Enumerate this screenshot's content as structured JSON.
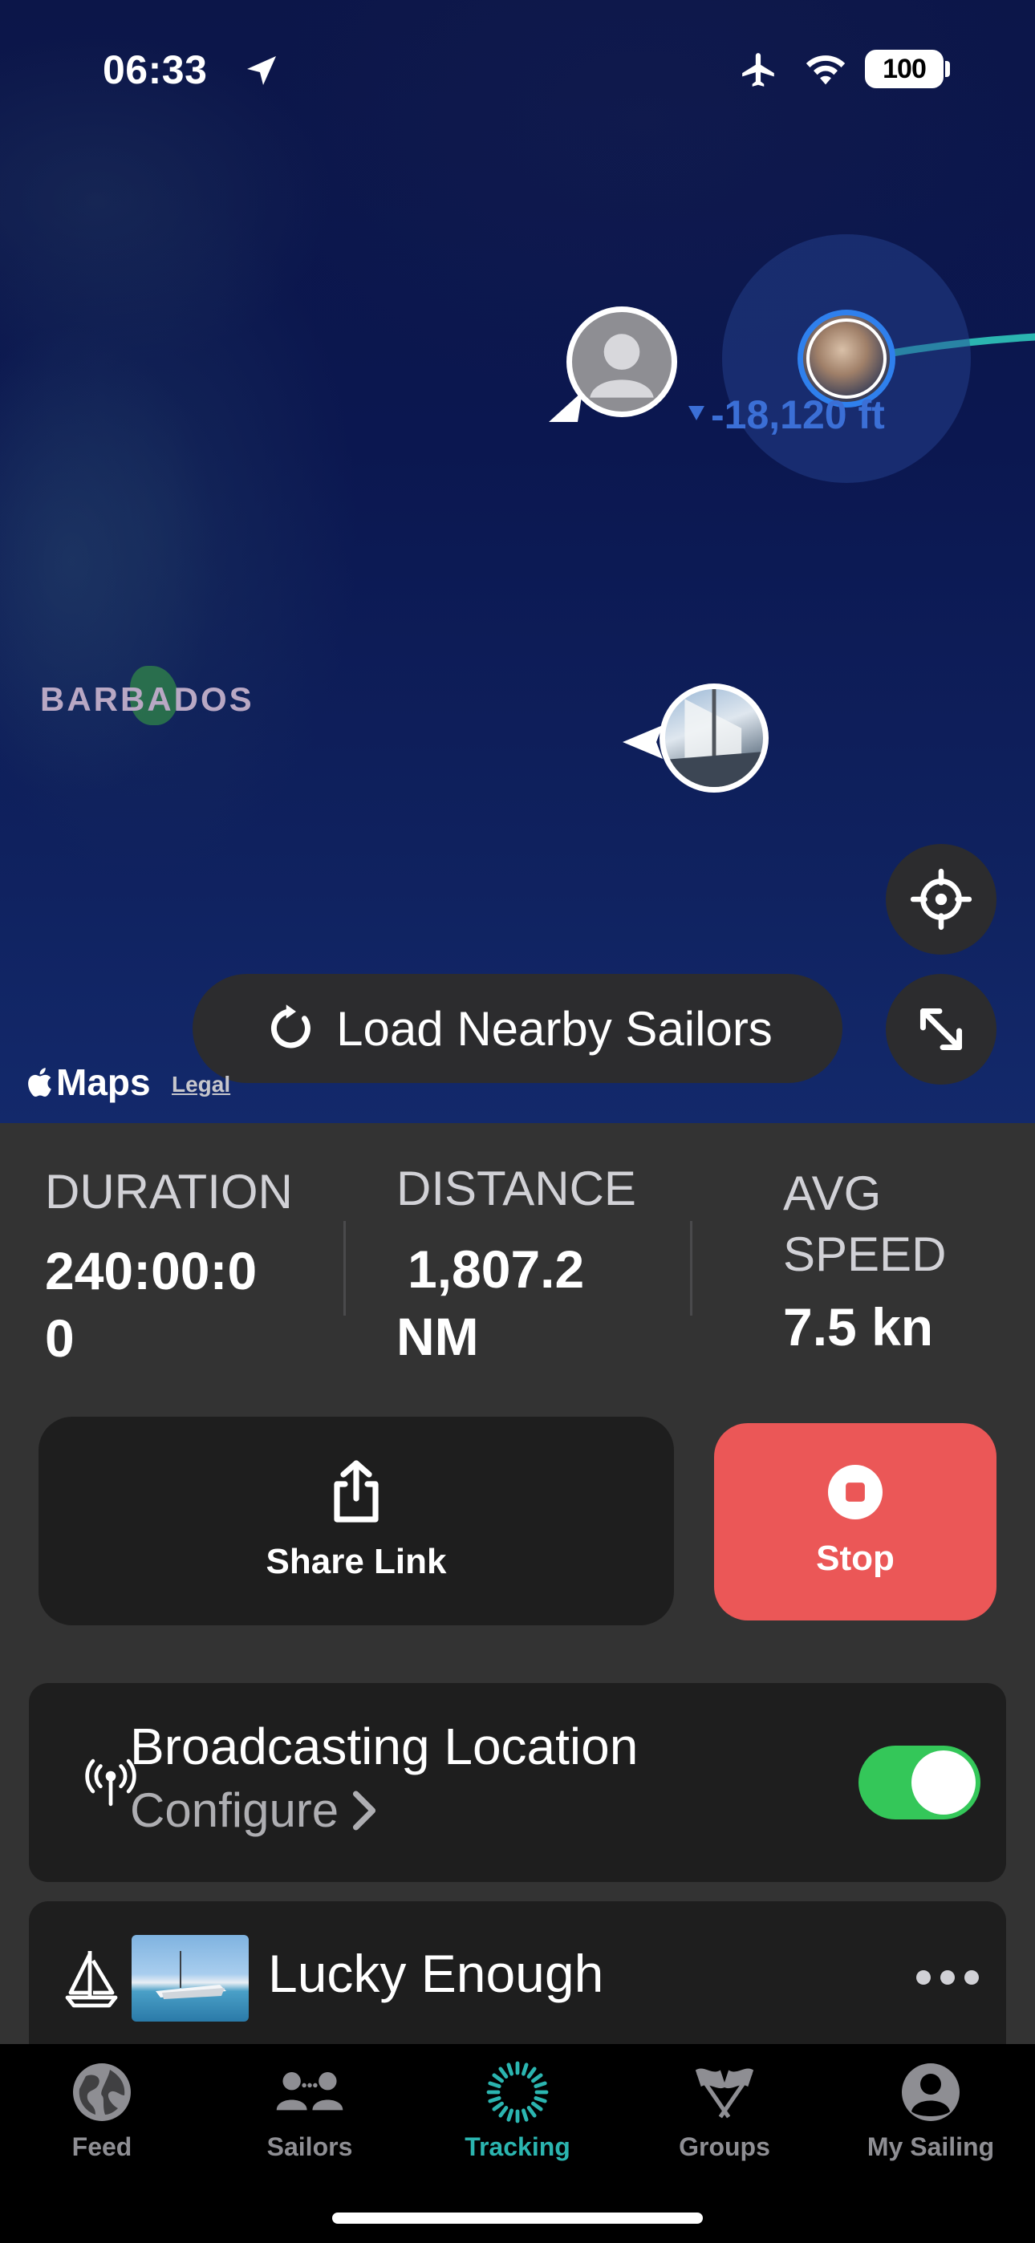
{
  "status_bar": {
    "time": "06:33",
    "battery": "100"
  },
  "map": {
    "altitude_label": "-18,120 ft",
    "island_label": "BARBADOS",
    "load_nearby_label": "Load Nearby Sailors",
    "maps_brand": "Maps",
    "legal_label": "Legal",
    "track_color": "#2bb5b0",
    "selected_ring_color": "#2f80ed"
  },
  "stats": {
    "duration": {
      "label": "DURATION",
      "value_line1": "240:00:0",
      "value_line2": "0"
    },
    "distance": {
      "label": "DISTANCE",
      "value_line1": "1,807.2",
      "value_line2": "NM"
    },
    "avg_speed": {
      "label_line1": "AVG",
      "label_line2": "SPEED",
      "value": "7.5 kn"
    }
  },
  "actions": {
    "share_label": "Share Link",
    "stop_label": "Stop",
    "stop_color": "#eb5757"
  },
  "broadcast": {
    "title": "Broadcasting Location",
    "configure_label": "Configure",
    "enabled": true,
    "toggle_color": "#34c759"
  },
  "boat": {
    "name": "Lucky Enough"
  },
  "tabs": [
    {
      "label": "Feed",
      "icon": "globe-icon",
      "active": false
    },
    {
      "label": "Sailors",
      "icon": "people-icon",
      "active": false
    },
    {
      "label": "Tracking",
      "icon": "tracking-ring-icon",
      "active": true
    },
    {
      "label": "Groups",
      "icon": "flags-icon",
      "active": false
    },
    {
      "label": "My Sailing",
      "icon": "person-circle-icon",
      "active": false
    }
  ],
  "accent_color": "#2bb5b0"
}
